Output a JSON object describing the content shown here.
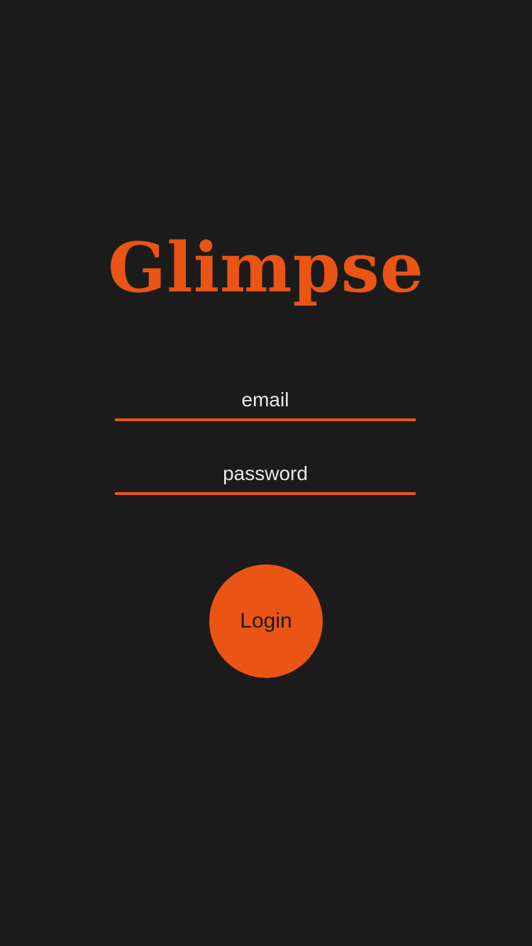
{
  "app": {
    "title": "Glimpse"
  },
  "login_form": {
    "email": {
      "placeholder": "email",
      "value": ""
    },
    "password": {
      "placeholder": "password",
      "value": ""
    },
    "submit_label": "Login"
  },
  "colors": {
    "background": "#1b1b1b",
    "accent": "#ea5414",
    "field_text": "#e8e8e8",
    "button_text": "#1b1b1b"
  }
}
